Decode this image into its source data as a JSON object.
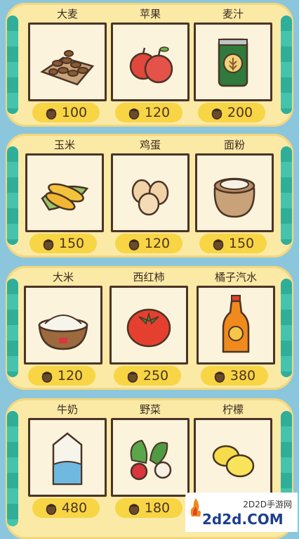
{
  "shop": {
    "rows": [
      {
        "items": [
          {
            "name": "大麦",
            "price": "100",
            "icon": "barley-icon"
          },
          {
            "name": "苹果",
            "price": "120",
            "icon": "apple-icon"
          },
          {
            "name": "麦汁",
            "price": "200",
            "icon": "wort-can-icon"
          }
        ]
      },
      {
        "items": [
          {
            "name": "玉米",
            "price": "150",
            "icon": "corn-icon"
          },
          {
            "name": "鸡蛋",
            "price": "120",
            "icon": "egg-icon"
          },
          {
            "name": "面粉",
            "price": "150",
            "icon": "flour-sack-icon"
          }
        ]
      },
      {
        "items": [
          {
            "name": "大米",
            "price": "120",
            "icon": "rice-bowl-icon"
          },
          {
            "name": "西红柿",
            "price": "250",
            "icon": "tomato-icon"
          },
          {
            "name": "橘子汽水",
            "price": "380",
            "icon": "orange-soda-icon"
          }
        ]
      },
      {
        "items": [
          {
            "name": "牛奶",
            "price": "480",
            "icon": "milk-carton-icon"
          },
          {
            "name": "野菜",
            "price": "180",
            "icon": "vegetables-icon"
          },
          {
            "name": "柠檬",
            "price": "",
            "icon": "lemon-icon"
          }
        ]
      }
    ]
  },
  "currency_icon": "acorn-icon",
  "watermark": {
    "site": "2D2D手游网",
    "domain": "2d2d.COM"
  },
  "colors": {
    "background": "#8cc6dc",
    "panel": "#fbe9a6",
    "price_pill": "#f7d545",
    "frame_border": "#4a3426"
  }
}
